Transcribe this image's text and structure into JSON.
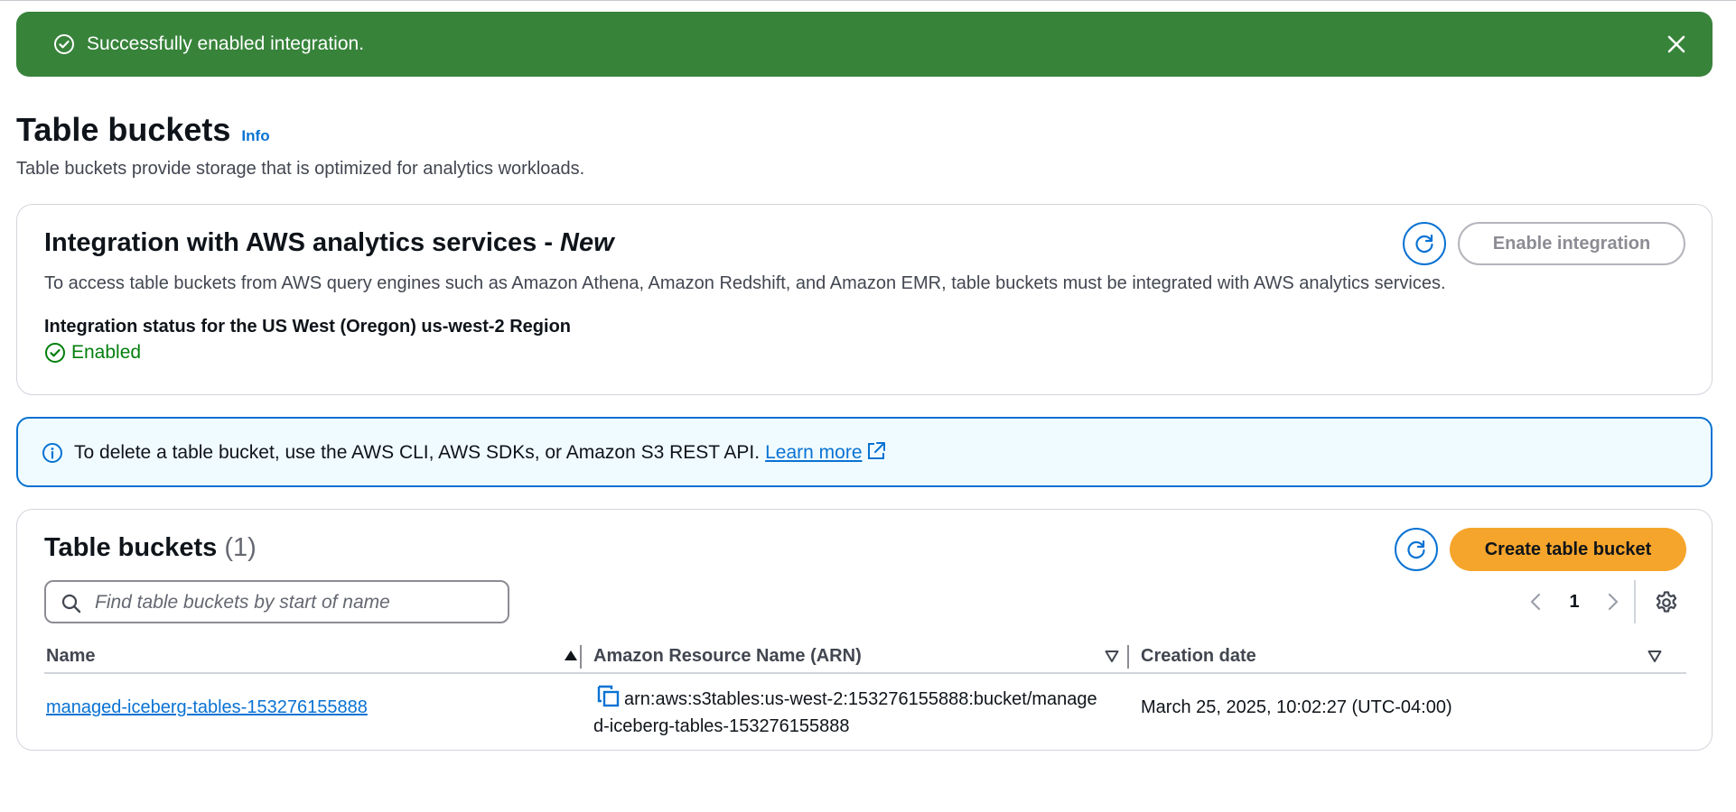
{
  "flash": {
    "message": "Successfully enabled integration.",
    "color": "#37833a"
  },
  "header": {
    "title": "Table buckets",
    "info_label": "Info",
    "description": "Table buckets provide storage that is optimized for analytics workloads."
  },
  "integration": {
    "title": "Integration with AWS analytics services - ",
    "title_badge": "New",
    "description": "To access table buckets from AWS query engines such as Amazon Athena, Amazon Redshift, and Amazon EMR, table buckets must be integrated with AWS analytics services.",
    "status_label": "Integration status for the US West (Oregon) us-west-2 Region",
    "status_value": "Enabled",
    "status_color": "#037f0c",
    "enable_button_label": "Enable integration"
  },
  "alert": {
    "text": "To delete a table bucket, use the AWS CLI, AWS SDKs, or Amazon S3 REST API.",
    "link_label": "Learn more",
    "color": "#0972d3"
  },
  "tables": {
    "title": "Table buckets",
    "count": "(1)",
    "create_button_label": "Create table bucket",
    "create_button_color": "#f5a52b",
    "search_placeholder": "Find table buckets by start of name",
    "search_value": "",
    "page": "1",
    "columns": {
      "name": "Name",
      "arn": "Amazon Resource Name (ARN)",
      "date": "Creation date"
    },
    "rows": [
      {
        "name": "managed-iceberg-tables-153276155888",
        "arn": "arn:aws:s3tables:us-west-2:153276155888:bucket/managed-iceberg-tables-153276155888",
        "created": "March 25, 2025, 10:02:27 (UTC-04:00)"
      }
    ]
  },
  "icons": [
    "check-circle-icon",
    "close-icon",
    "refresh-icon",
    "info-icon",
    "external-link-icon",
    "search-icon",
    "chevron-left-icon",
    "chevron-right-icon",
    "settings-icon",
    "sort-ascending-icon",
    "sort-icon",
    "copy-icon"
  ]
}
